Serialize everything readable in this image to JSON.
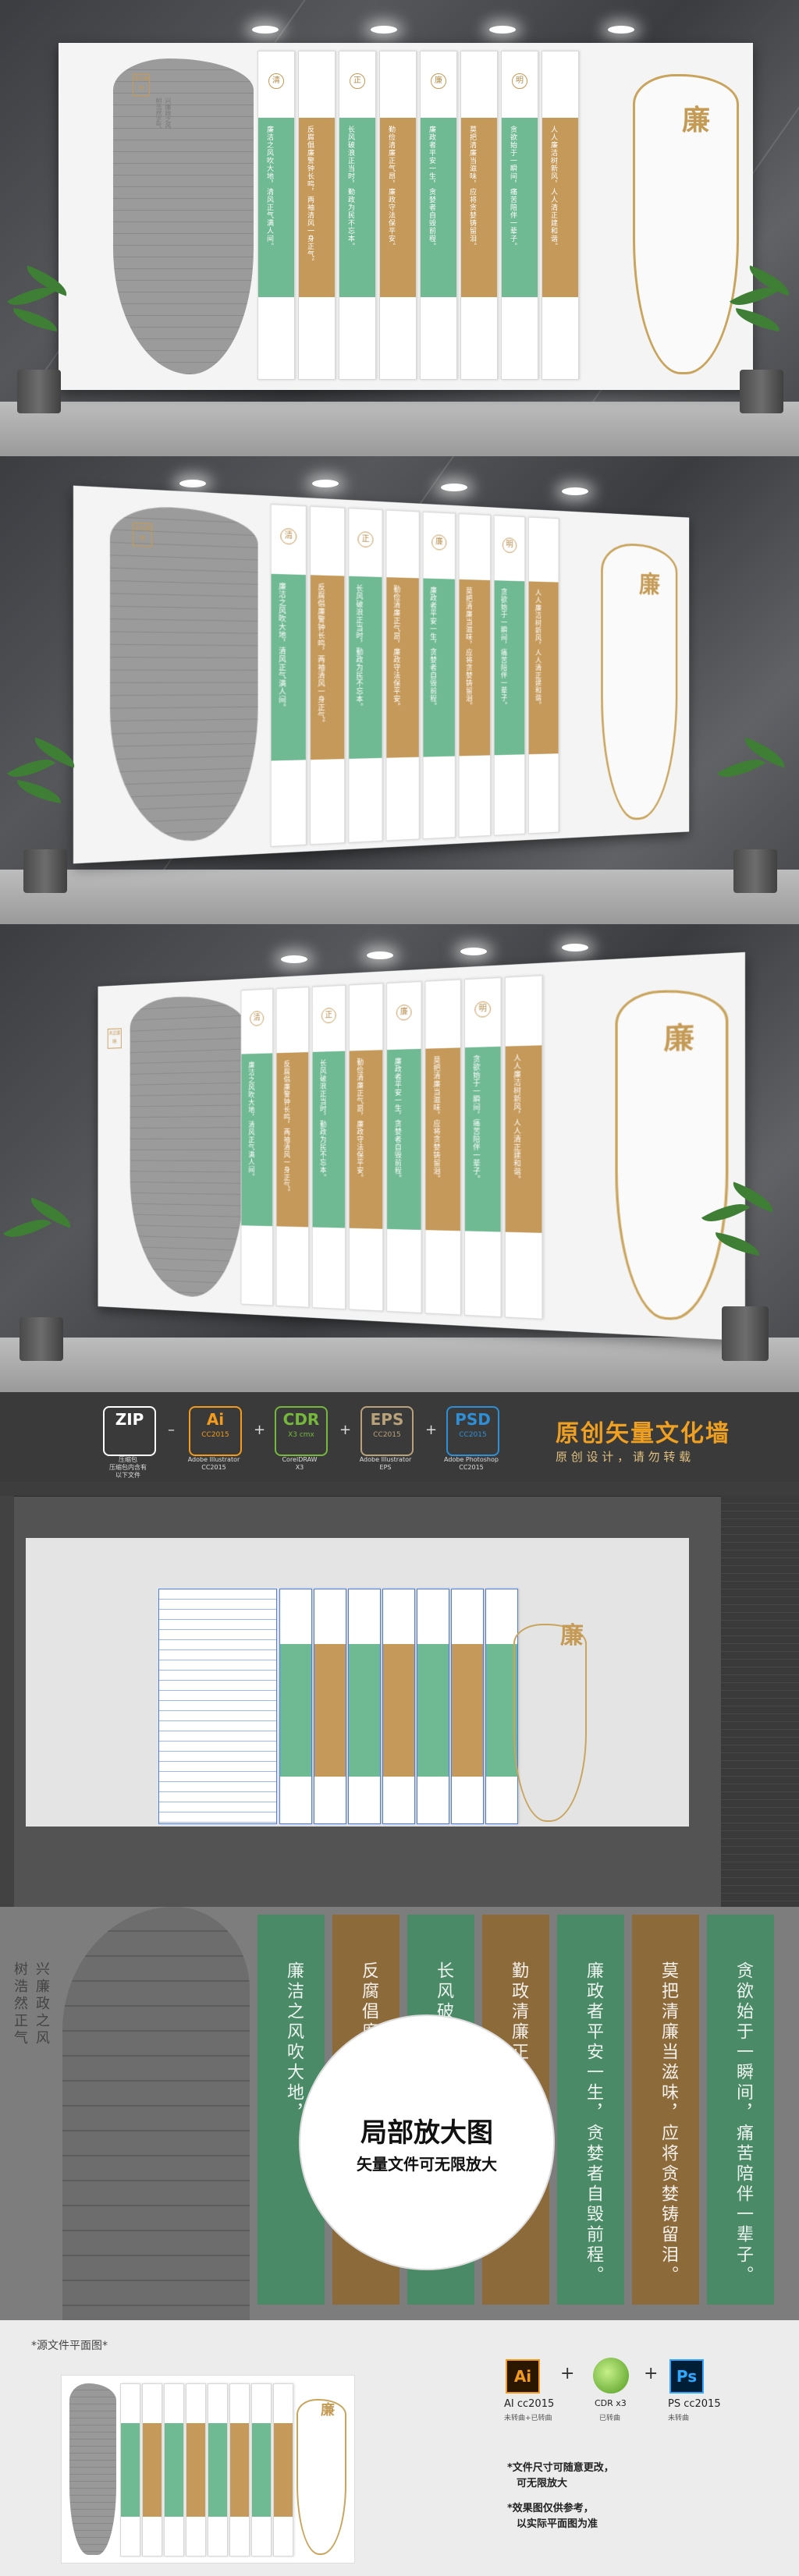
{
  "wall": {
    "title_char": "廉",
    "seal_text": "清正廉明",
    "slogan_lines": [
      "兴廉政之风",
      "树浩然正气"
    ],
    "circle_chars": [
      "清",
      "正",
      "廉",
      "明"
    ],
    "strip_texts": [
      "廉洁之风吹大地，清风正气满人间。",
      "反腐倡廉警钟长鸣，两袖清风一身正气。",
      "长风破浪正当时，勤政为民不忘本。",
      "勤俭清廉正气昂，廉政守法保平安。",
      "廉政者平安一生，贪婪者自毁前程。",
      "莫把清廉当滋味，应将贪婪铸留泪。",
      "贪欲始于一瞬间，痛苦陪伴一辈子。",
      "人人廉洁树新风，人人清正建和谐。"
    ]
  },
  "banner": {
    "formats": [
      {
        "ext": "ZIP",
        "ver": "",
        "caption": "压缩包\n压缩包内含有\n以下文件",
        "color": "#ffffff"
      },
      {
        "ext": "Ai",
        "ver": "CC2015",
        "caption": "Adobe Illustrator\nCC2015",
        "color": "#f29b1d"
      },
      {
        "ext": "CDR",
        "ver": "X3 cmx",
        "caption": "CorelDRAW\nX3",
        "color": "#75b83c"
      },
      {
        "ext": "EPS",
        "ver": "CC2015",
        "caption": "Adobe Illustrator\nEPS",
        "color": "#b9a27a"
      },
      {
        "ext": "PSD",
        "ver": "CC2015",
        "caption": "Adobe Photoshop\nCC2015",
        "color": "#2e8fd6"
      }
    ],
    "title": "原创矢量文化墙",
    "subtitle": "原 创 设 计 ， 请 勿 转 载"
  },
  "zoom": {
    "slogan_lines": [
      "兴廉政之风",
      "树浩然正气"
    ],
    "columns": [
      "廉洁之风吹大地，",
      "反腐倡廉",
      "长风破浪",
      "勤政清廉正气昂，平安兴。",
      "廉政者平安一生，贪婪者自毁前程。",
      "莫把清廉当滋味，应将贪婪铸留泪。",
      "贪欲始于一瞬间，痛苦陪伴一辈子。"
    ],
    "badge_title": "局部放大图",
    "badge_subtitle": "矢量文件可无限放大"
  },
  "bottom": {
    "section_label": "*源文件平面图*",
    "software": [
      {
        "name": "Ai",
        "label": "AI cc2015",
        "sub": "未转曲+已转曲",
        "color": "#f29b1d",
        "bg": "#2b1700"
      },
      {
        "name": "CDR",
        "label": "CDR x3",
        "sub": "已转曲",
        "color": "#75b83c",
        "bg": "#ffffff"
      },
      {
        "name": "Ps",
        "label": "PS cc2015",
        "sub": "未转曲",
        "color": "#31a8ff",
        "bg": "#001e36"
      }
    ],
    "notes": [
      "*文件尺寸可随意更改，",
      "可无限放大",
      "*效果图仅供参考，",
      "以实际平面图为准"
    ]
  }
}
